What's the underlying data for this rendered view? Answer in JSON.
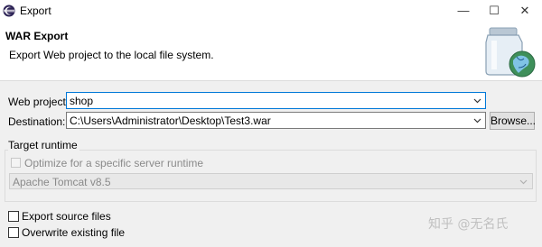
{
  "window": {
    "title": "Export",
    "controls": {
      "minimize": "—",
      "maximize": "☐",
      "close": "✕"
    }
  },
  "header": {
    "title": "WAR Export",
    "description": "Export Web project to the local file system."
  },
  "form": {
    "web_project_label": "Web project:",
    "web_project_value": "shop",
    "destination_label": "Destination:",
    "destination_value": "C:\\Users\\Administrator\\Desktop\\Test3.war",
    "browse_label": "Browse..."
  },
  "target_runtime": {
    "group_label": "Target runtime",
    "optimize_label": "Optimize for a specific server runtime",
    "runtime_value": "Apache Tomcat v8.5"
  },
  "options": {
    "export_source_label": "Export source files",
    "overwrite_label": "Overwrite existing file"
  },
  "watermark": "知乎 @无名氏",
  "icons": {
    "app": "eclipse-icon",
    "wizard": "war-jar-globe-icon",
    "dropdown": "chevron-down-icon"
  }
}
